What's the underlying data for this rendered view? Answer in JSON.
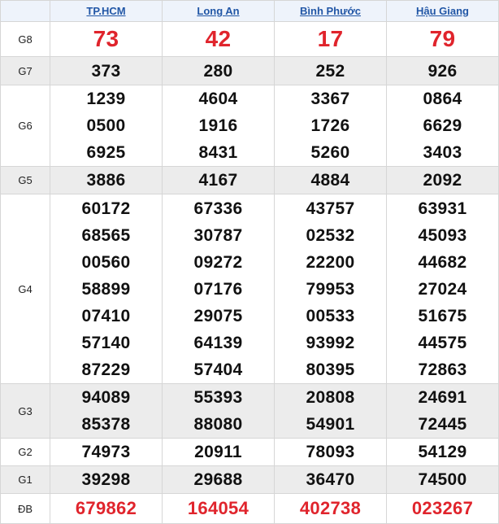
{
  "provinces": [
    "TP.HCM",
    "Long An",
    "Bình Phước",
    "Hậu Giang"
  ],
  "rows": [
    {
      "label": "G8",
      "values": [
        [
          "73"
        ],
        [
          "42"
        ],
        [
          "17"
        ],
        [
          "79"
        ]
      ]
    },
    {
      "label": "G7",
      "values": [
        [
          "373"
        ],
        [
          "280"
        ],
        [
          "252"
        ],
        [
          "926"
        ]
      ]
    },
    {
      "label": "G6",
      "values": [
        [
          "1239",
          "0500",
          "6925"
        ],
        [
          "4604",
          "1916",
          "8431"
        ],
        [
          "3367",
          "1726",
          "5260"
        ],
        [
          "0864",
          "6629",
          "3403"
        ]
      ]
    },
    {
      "label": "G5",
      "values": [
        [
          "3886"
        ],
        [
          "4167"
        ],
        [
          "4884"
        ],
        [
          "2092"
        ]
      ]
    },
    {
      "label": "G4",
      "values": [
        [
          "60172",
          "68565",
          "00560",
          "58899",
          "07410",
          "57140",
          "87229"
        ],
        [
          "67336",
          "30787",
          "09272",
          "07176",
          "29075",
          "64139",
          "57404"
        ],
        [
          "43757",
          "02532",
          "22200",
          "79953",
          "00533",
          "93992",
          "80395"
        ],
        [
          "63931",
          "45093",
          "44682",
          "27024",
          "51675",
          "44575",
          "72863"
        ]
      ]
    },
    {
      "label": "G3",
      "values": [
        [
          "94089",
          "85378"
        ],
        [
          "55393",
          "88080"
        ],
        [
          "20808",
          "54901"
        ],
        [
          "24691",
          "72445"
        ]
      ]
    },
    {
      "label": "G2",
      "values": [
        [
          "74973"
        ],
        [
          "20911"
        ],
        [
          "78093"
        ],
        [
          "54129"
        ]
      ]
    },
    {
      "label": "G1",
      "values": [
        [
          "39298"
        ],
        [
          "29688"
        ],
        [
          "36470"
        ],
        [
          "74500"
        ]
      ]
    },
    {
      "label": "ĐB",
      "values": [
        [
          "679862"
        ],
        [
          "164054"
        ],
        [
          "402738"
        ],
        [
          "023267"
        ]
      ]
    }
  ],
  "colors": {
    "header_bg": "#eef3fb",
    "link": "#2156a6",
    "special_red": "#e0242c",
    "shade": "#ececec"
  }
}
